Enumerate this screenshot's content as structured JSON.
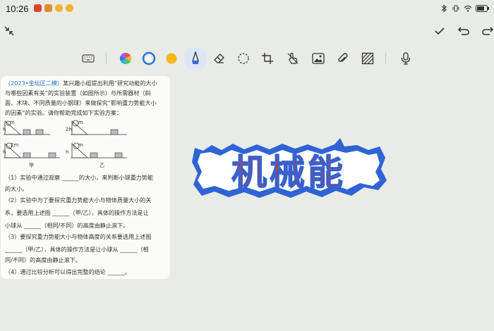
{
  "status": {
    "time": "10:26",
    "apps": [
      {
        "name": "app-a",
        "color": "#d9452f"
      },
      {
        "name": "app-b",
        "color": "#e38a2c"
      },
      {
        "name": "app-c",
        "color": "#f0b431"
      },
      {
        "name": "app-d",
        "color": "#f0b431"
      }
    ],
    "right_icons": [
      "bluetooth-icon",
      "vibrate-icon",
      "wifi-icon",
      "battery-icon"
    ]
  },
  "topbar": {
    "left_icon": "collapse-arrows-icon",
    "right_icons": [
      "check-icon",
      "undo-icon",
      "redo-icon"
    ]
  },
  "tools": [
    "keyboard-icon",
    "color-wheel-icon",
    "pen-color-blue-icon",
    "pen-color-yellow-icon",
    "pen-icon",
    "eraser-icon",
    "lasso-icon",
    "crop-icon",
    "finger-draw-icon",
    "image-icon",
    "attachment-icon",
    "texture-icon",
    "microphone-icon"
  ],
  "colors": {
    "accent": "#2f6fe0",
    "yellow": "#f2b61b",
    "sticker_blue": "#2f63d6",
    "sticker_red": "#e0352d"
  },
  "question": {
    "tag": "（2023•金坛区二模）",
    "lines": [
      "某兴趣小组提出利用“研究动能的大小",
      "与哪些因素有关”的实验装置（如图所示）与所需器材（斜",
      "面、木块、不同质量的小钢球）来做探究“影响重力势能大小",
      "的因素”的实验。请你帮助完成如下实验方案："
    ],
    "figure_labels": {
      "jia": "甲",
      "yi": "乙",
      "m": "m",
      "twom": "2m",
      "h": "h",
      "twoh": "2h"
    },
    "items": [
      "（1）实验中通过观察 ______的大小，来判断小球重力势能",
      "的大小。",
      "（2）实验中为了要探究重力势能大小与物体质量大小的关",
      "系，要选用上述图 ______（甲/乙），具体的操作方法是让",
      "小球从 ______（相同/不同）的高度由静止滚下。",
      "（3）要探究重力势能大小与物体高度的关系要选用上述图",
      "______（甲/乙），具体的操作方法是让小球从 ______（相",
      "同/不同）的高度由静止滚下。",
      "（4）通过比较分析可以得出完整的结论 ______。"
    ]
  },
  "sticker": {
    "text": "机械能"
  }
}
